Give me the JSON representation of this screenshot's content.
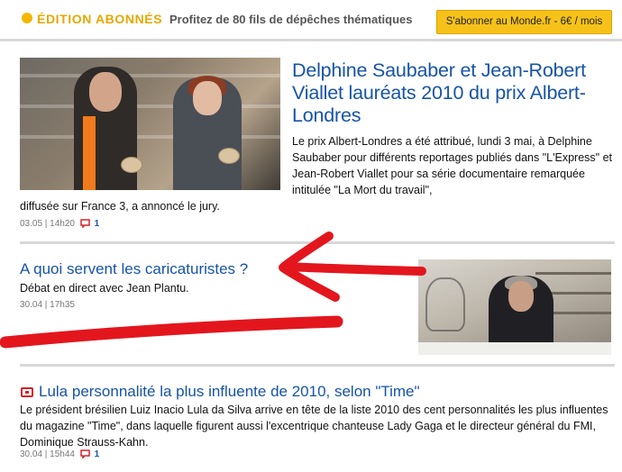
{
  "header": {
    "edition_label": "ÉDITION ABONNÉS",
    "promo_text": "Profitez de 80 fils de dépêches thématiques",
    "subscribe_label": "S'abonner au Monde.fr - 6€ / mois"
  },
  "articles": [
    {
      "title": "Delphine Saubaber et Jean-Robert Viallet lauréats 2010 du prix Albert-Londres",
      "lead_part1": "Le prix Albert-Londres a été attribué, lundi 3 mai, à Delphine Saubaber pour différents reportages publiés dans \"L'Express\" et Jean-Robert Viallet pour sa série documentaire remarquée intitulée \"La Mort du travail\",",
      "lead_part2": "diffusée sur France 3, a annoncé le jury.",
      "meta": "03.05 | 14h20",
      "comments": "1"
    },
    {
      "title": "A quoi servent les caricaturistes ?",
      "lead": "Débat en direct avec Jean Plantu.",
      "meta": "30.04 | 17h35"
    },
    {
      "title": "Lula personnalité la plus influente de 2010, selon \"Time\"",
      "lead": "Le président brésilien Luiz Inacio Lula da Silva arrive en tête de la liste 2010 des cent personnalités les plus influentes du magazine \"Time\", dans laquelle figurent aussi l'excentrique chanteuse Lady Gaga et le directeur général du FMI, Dominique Strauss-Kahn.",
      "meta": "30.04 | 15h44",
      "comments": "1"
    }
  ],
  "colors": {
    "link": "#1654a8",
    "accent": "#f2b705",
    "annotation": "#e3161e"
  },
  "icons": {
    "comment": "comment-bubble-icon",
    "video": "video-icon",
    "edition": "edition-dot-icon"
  }
}
